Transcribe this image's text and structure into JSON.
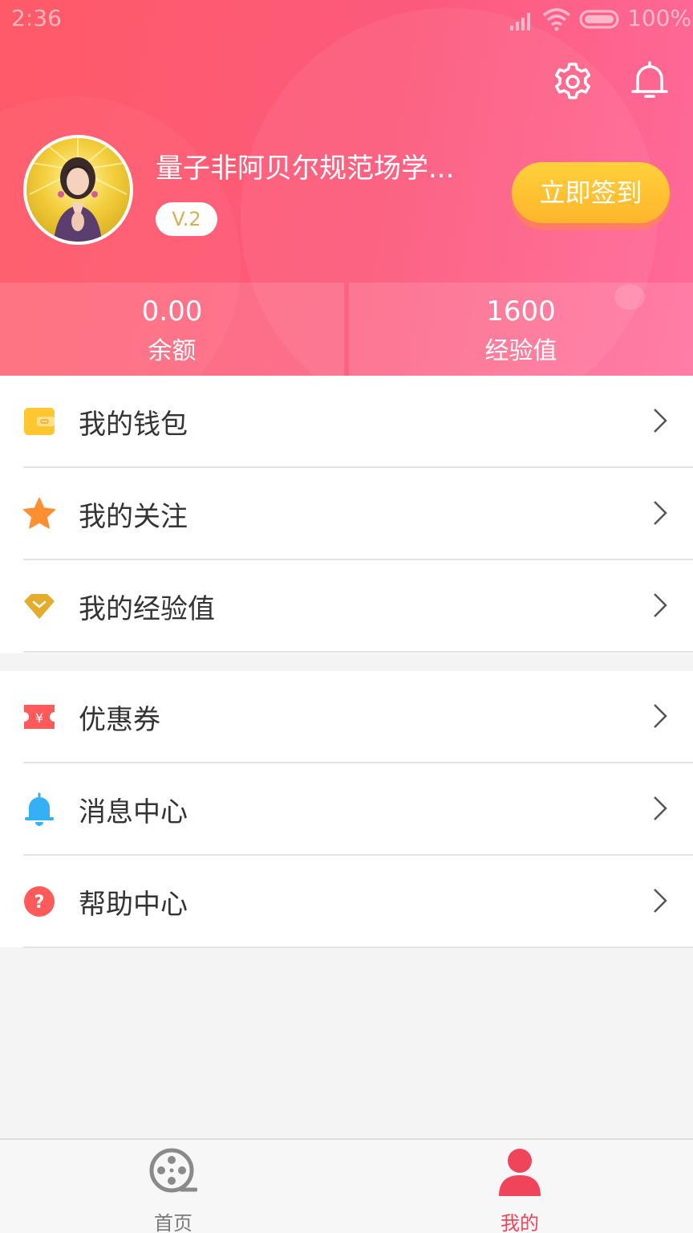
{
  "status_bar": {
    "time": "2:36",
    "battery": "100%"
  },
  "header": {
    "username": "量子非阿贝尔规范场学...",
    "level": "V.2",
    "signin_label": "立即签到",
    "balance_value": "0.00",
    "balance_label": "余额",
    "exp_value": "1600",
    "exp_label": "经验值"
  },
  "menu_group1": [
    {
      "label": "我的钱包",
      "icon": "wallet-icon"
    },
    {
      "label": "我的关注",
      "icon": "star-icon"
    },
    {
      "label": "我的经验值",
      "icon": "diamond-icon"
    }
  ],
  "menu_group2": [
    {
      "label": "优惠券",
      "icon": "coupon-icon"
    },
    {
      "label": "消息中心",
      "icon": "bell-icon"
    },
    {
      "label": "帮助中心",
      "icon": "help-icon"
    }
  ],
  "bottom_nav": {
    "home_label": "首页",
    "mine_label": "我的"
  },
  "colors": {
    "accent": "#f0445a",
    "header_start": "#ff5a68",
    "header_end": "#ff6a9a",
    "signin_button": "#ffc233"
  }
}
